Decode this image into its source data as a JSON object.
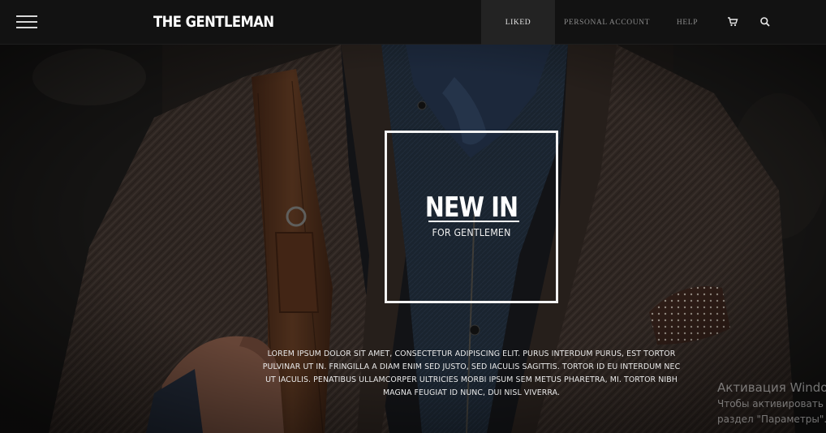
{
  "header": {
    "logo": "THE GENTLEMAN",
    "nav": {
      "liked": "LIKED",
      "personal_account": "PERSONAL ACCOUNT",
      "help": "HELP"
    },
    "icons": [
      "menu-icon",
      "cart-icon",
      "search-icon"
    ]
  },
  "hero": {
    "headline": "NEW IN",
    "subline": "FOR GENTLEMEN",
    "description": "Lorem ipsum dolor sit amet, consectetur adipiscing elit. Purus interdum purus, est tortor pulvinar ut in. Fringilla a diam enim sed justo, sed iaculis sagittis. Tortor id eu interdum nec ut iaculis. Penatibus ullamcorper ultricies morbi ipsum sem metus pharetra, mi. Tortor nibh magna feugiat id nunc, dui nisl viverra."
  },
  "system_overlay": {
    "line1": "Активация Windows",
    "line2": "Чтобы активировать Windows, перейдите в",
    "line3": "раздел \"Параметры\"."
  },
  "colors": {
    "topbar": "#121212",
    "active_tab": "#232323",
    "text_primary": "#ffffff",
    "nav_text": "#8a8a8a"
  }
}
